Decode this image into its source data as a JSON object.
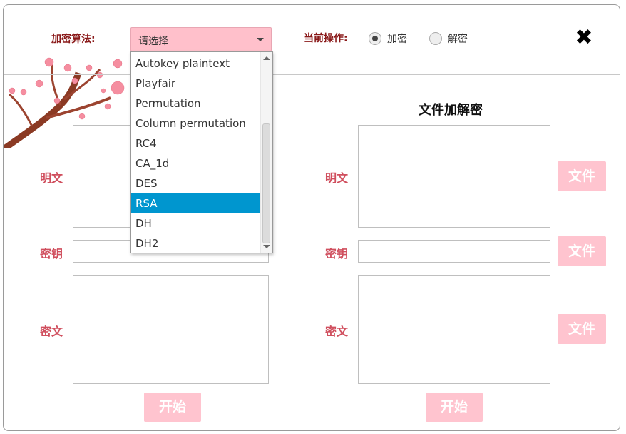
{
  "header": {
    "algorithm_label": "加密算法:",
    "algorithm_placeholder": "请选择",
    "operation_label": "当前操作:",
    "op_encrypt": "加密",
    "op_decrypt": "解密",
    "selected_operation": "加密",
    "close_glyph": "✖"
  },
  "dropdown": {
    "options": [
      "Autokey plaintext",
      "Playfair",
      "Permutation",
      "Column permutation",
      "RC4",
      "CA_1d",
      "DES",
      "RSA",
      "DH",
      "DH2"
    ],
    "highlighted": "RSA"
  },
  "left_panel": {
    "plaintext_label": "明文",
    "key_label": "密钥",
    "ciphertext_label": "密文",
    "start_button": "开始"
  },
  "right_panel": {
    "title": "文件加解密",
    "plaintext_label": "明文",
    "key_label": "密钥",
    "ciphertext_label": "密文",
    "file_button": "文件",
    "start_button": "开始"
  },
  "colors": {
    "accent_pink": "#ffc4cf",
    "label_red": "#d04f5e",
    "highlight_blue": "#0096cf"
  }
}
